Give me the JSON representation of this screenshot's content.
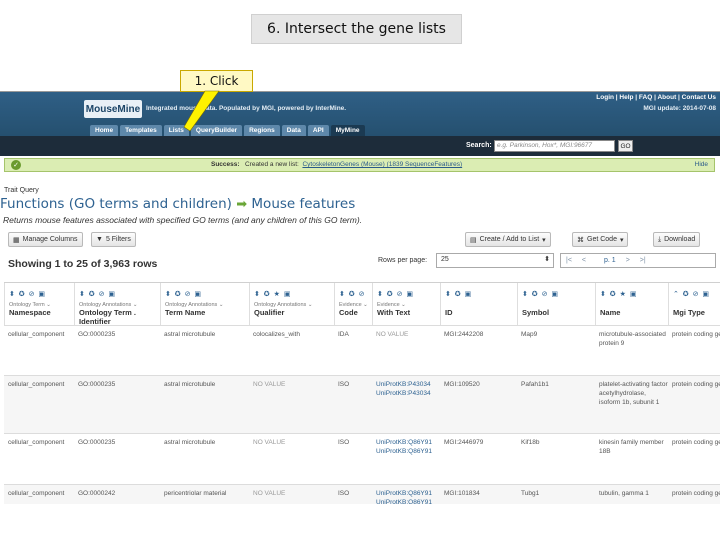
{
  "slide": {
    "title": "6. Intersect the gene lists",
    "callout": "1. Click"
  },
  "site": {
    "logo": "MouseMine",
    "tagline": "Integrated mouse data. Populated by MGI, powered by InterMine.",
    "top_links": "Login | Help | FAQ | About | Contact Us",
    "mgi_update": "MGI update: 2014-07-08",
    "nav_tabs": [
      "Home",
      "Templates",
      "Lists",
      "QueryBuilder",
      "Regions",
      "Data",
      "API",
      "MyMine"
    ],
    "search_label": "Search:",
    "search_placeholder": "e.g. Parkinson, Hox*, MGI:96677",
    "go_label": "GO"
  },
  "success": {
    "label": "Success:",
    "text": "Created a new list:",
    "list_name": "CytoskeletonGenes (Mouse) (1839 SequenceFeatures)",
    "hide": "Hide"
  },
  "query": {
    "breadcrumb": "Trait Query",
    "title_left": "Functions (GO terms and children)",
    "title_right": "Mouse features",
    "subtitle": "Returns mouse features associated with specified GO terms (and any children of this GO term)."
  },
  "toolbar": {
    "manage_columns": "Manage Columns",
    "filters": "5 Filters",
    "create_list": "Create / Add to List",
    "get_code": "Get Code",
    "download": "Download"
  },
  "results": {
    "showing": "Showing 1 to 25 of 3,963 rows",
    "rows_per_page_label": "Rows per page:",
    "rows_per_page_value": "25",
    "pager": [
      "|<",
      "<",
      "p. 1",
      ">",
      ">|"
    ]
  },
  "columns": [
    {
      "cls": "Ontology Term",
      "field": "Namespace"
    },
    {
      "cls": "Ontology Annotations",
      "field": "Ontology Term . Identifier"
    },
    {
      "cls": "Ontology Annotations",
      "field": "Term Name"
    },
    {
      "cls": "Ontology Annotations",
      "field": "Qualifier"
    },
    {
      "cls": "Evidence",
      "field": "Code"
    },
    {
      "cls": "Evidence",
      "field": "With Text"
    },
    {
      "cls": "",
      "field": "ID"
    },
    {
      "cls": "",
      "field": "Symbol"
    },
    {
      "cls": "",
      "field": "Name"
    },
    {
      "cls": "",
      "field": "Mgi Type"
    }
  ],
  "rows": [
    [
      "cellular_component",
      "GO:0000235",
      "astral microtubule",
      "colocalizes_with",
      "IDA",
      "NO VALUE",
      "MGI:2442208",
      "Map9",
      "microtubule-associated protein 9",
      "protein coding ge"
    ],
    [
      "cellular_component",
      "GO:0000235",
      "astral microtubule",
      "NO VALUE",
      "ISO",
      "UniProtKB:P43034 UniProtKB:P43034",
      "MGI:109520",
      "Pafah1b1",
      "platelet-activating factor acetylhydrolase, isoform 1b, subunit 1",
      "protein coding ge"
    ],
    [
      "cellular_component",
      "GO:0000235",
      "astral microtubule",
      "NO VALUE",
      "ISO",
      "UniProtKB:Q86Y91 UniProtKB:Q86Y91",
      "MGI:2446979",
      "Kif18b",
      "kinesin family member 18B",
      "protein coding ge"
    ],
    [
      "cellular_component",
      "GO:0000242",
      "pericentriolar material",
      "NO VALUE",
      "ISO",
      "UniProtKB:Q86Y91 UniProtKB:Q86Y91",
      "MGI:101834",
      "Tubg1",
      "tubulin, gamma 1",
      "protein coding ge"
    ]
  ]
}
